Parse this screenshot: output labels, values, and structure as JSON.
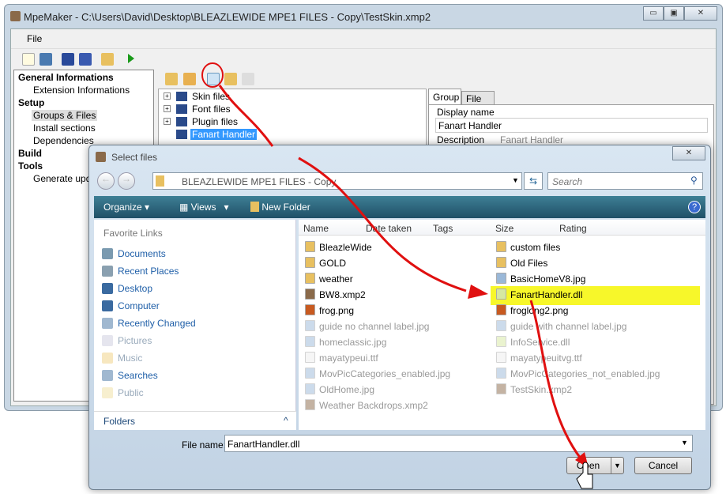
{
  "main_window": {
    "title": "MpeMaker - C:\\Users\\David\\Desktop\\BLEAZLEWIDE MPE1 FILES - Copy\\TestSkin.xmp2",
    "menu": [
      "File"
    ],
    "left_panel": [
      {
        "label": "General Informations",
        "level": 0
      },
      {
        "label": "Extension Informations",
        "level": 1
      },
      {
        "label": "Setup",
        "level": 0
      },
      {
        "label": "Groups & Files",
        "level": 1,
        "selected": true
      },
      {
        "label": "Install sections",
        "level": 1
      },
      {
        "label": "Dependencies",
        "level": 1
      },
      {
        "label": "Build",
        "level": 0
      },
      {
        "label": "Tools",
        "level": 0
      },
      {
        "label": "Generate upda",
        "level": 1
      }
    ],
    "tree": [
      {
        "label": "Skin files"
      },
      {
        "label": "Font files"
      },
      {
        "label": "Plugin files"
      },
      {
        "label": "Fanart Handler",
        "selected": true
      }
    ],
    "tabs": [
      "Group",
      "File"
    ],
    "display_name_label": "Display name",
    "display_name_value": "Fanart Handler",
    "description_label": "Description",
    "description_value": "Fanart Handler"
  },
  "dialog": {
    "title": "Select files",
    "address": "BLEAZLEWIDE MPE1 FILES - Copy",
    "search_placeholder": "Search",
    "toolbar": {
      "organize": "Organize",
      "views": "Views",
      "new_folder": "New Folder"
    },
    "favorite_links_label": "Favorite Links",
    "favorites": [
      {
        "label": "Documents",
        "dim": false
      },
      {
        "label": "Recent Places",
        "dim": false
      },
      {
        "label": "Desktop",
        "dim": false
      },
      {
        "label": "Computer",
        "dim": false
      },
      {
        "label": "Recently Changed",
        "dim": false
      },
      {
        "label": "Pictures",
        "dim": true
      },
      {
        "label": "Music",
        "dim": true
      },
      {
        "label": "Searches",
        "dim": false
      },
      {
        "label": "Public",
        "dim": true
      }
    ],
    "columns": [
      "Name",
      "Date taken",
      "Tags",
      "Size",
      "Rating"
    ],
    "files_col1": [
      {
        "name": "BleazleWide",
        "type": "folder"
      },
      {
        "name": "GOLD",
        "type": "folder"
      },
      {
        "name": "weather",
        "type": "folder"
      },
      {
        "name": "BW8.xmp2",
        "type": "pkg"
      },
      {
        "name": "frog.png",
        "type": "png"
      },
      {
        "name": "guide no channel label.jpg",
        "type": "jpg",
        "dim": true
      },
      {
        "name": "homeclassic.jpg",
        "type": "jpg",
        "dim": true
      },
      {
        "name": "mayatypeui.ttf",
        "type": "ttf",
        "dim": true
      },
      {
        "name": "MovPicCategories_enabled.jpg",
        "type": "jpg",
        "dim": true
      },
      {
        "name": "OldHome.jpg",
        "type": "jpg",
        "dim": true
      },
      {
        "name": "Weather Backdrops.xmp2",
        "type": "pkg",
        "dim": true
      }
    ],
    "files_col2": [
      {
        "name": "custom files",
        "type": "folder"
      },
      {
        "name": "Old Files",
        "type": "folder"
      },
      {
        "name": "BasicHomeV8.jpg",
        "type": "jpg"
      },
      {
        "name": "FanartHandler.dll",
        "type": "dll",
        "selected": true
      },
      {
        "name": "froglong2.png",
        "type": "png"
      },
      {
        "name": "guide with channel label.jpg",
        "type": "jpg",
        "dim": true
      },
      {
        "name": "InfoService.dll",
        "type": "dll",
        "dim": true
      },
      {
        "name": "mayatypeuitvg.ttf",
        "type": "ttf",
        "dim": true
      },
      {
        "name": "MovPicCategories_not_enabled.jpg",
        "type": "jpg",
        "dim": true
      },
      {
        "name": "TestSkin.xmp2",
        "type": "pkg",
        "dim": true
      }
    ],
    "folders_label": "Folders",
    "file_name_label": "File name:",
    "file_name_value": "FanartHandler.dll",
    "open_label": "Open",
    "cancel_label": "Cancel"
  },
  "colors": {
    "annotation_arrow": "#e01010",
    "highlight": "#f7f72a",
    "selection": "#3399ff"
  }
}
